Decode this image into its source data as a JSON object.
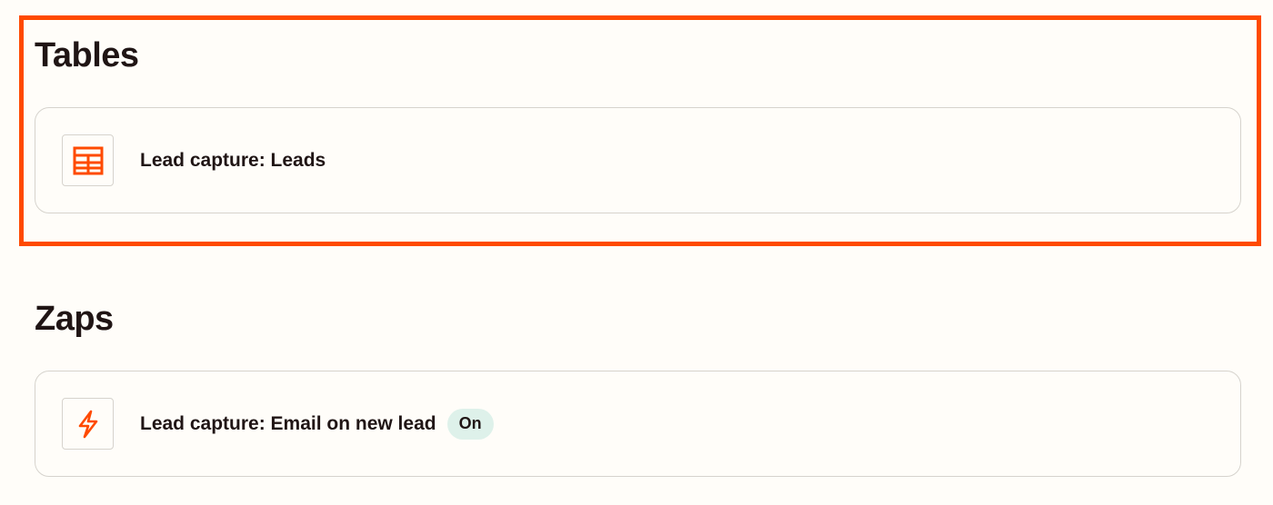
{
  "sections": {
    "tables": {
      "title": "Tables",
      "items": [
        {
          "label": "Lead capture: Leads",
          "icon": "table-icon"
        }
      ]
    },
    "zaps": {
      "title": "Zaps",
      "items": [
        {
          "label": "Lead capture: Email on new lead",
          "icon": "lightning-bolt-icon",
          "status": "On"
        }
      ]
    }
  },
  "colors": {
    "accent": "#ff4a00",
    "background": "#fffdf9",
    "border": "#d6d3cd",
    "status_on_bg": "#def1ea",
    "text": "#201515"
  }
}
